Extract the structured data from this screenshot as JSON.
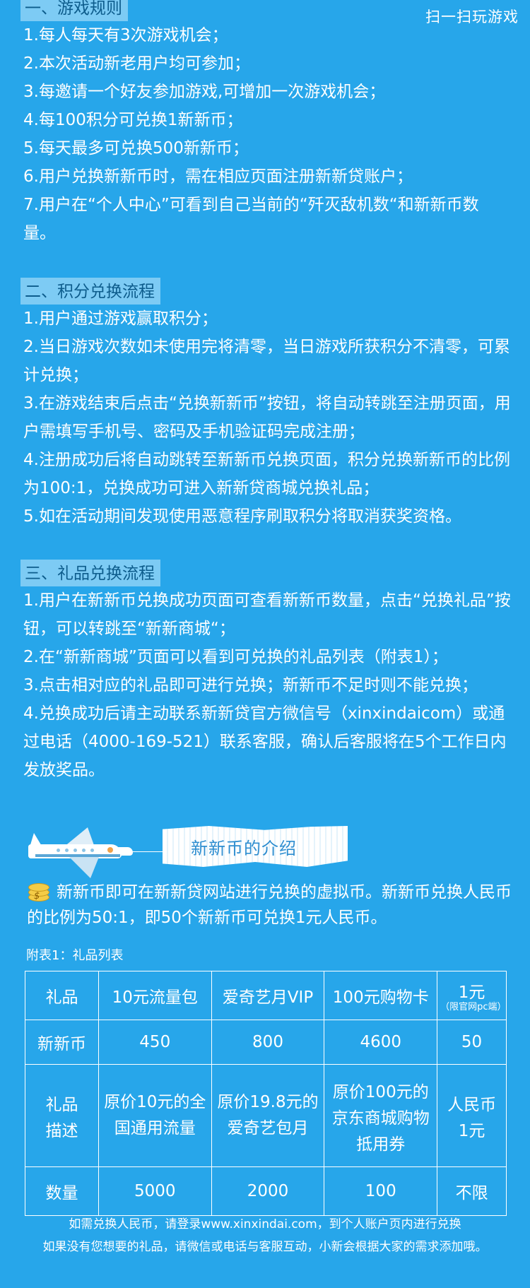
{
  "scan_link": "扫一扫玩游戏",
  "sections": [
    {
      "title": "一、游戏规则",
      "items": [
        "1.每人每天有3次游戏机会；",
        "2.本次活动新老用户均可参加；",
        "3.每邀请一个好友参加游戏,可增加一次游戏机会；",
        "4.每100积分可兑换1新新币；",
        "5.每天最多可兑换500新新币；",
        "6.用户兑换新新币时，需在相应页面注册新新贷账户；",
        "7.用户在“个人中心”可看到自己当前的“歼灭敌机数“和新新币数量。"
      ]
    },
    {
      "title": "二、积分兑换流程",
      "items": [
        "1.用户通过游戏赢取积分；",
        "2.当日游戏次数如未使用完将清零，当日游戏所获积分不清零，可累计兑换；",
        "3.在游戏结束后点击“兑换新新币”按钮，将自动转跳至注册页面，用户需填写手机号、密码及手机验证码完成注册；",
        "4.注册成功后将自动跳转至新新币兑换页面，积分兑换新新币的比例为100:1，兑换成功可进入新新贷商城兑换礼品；",
        "5.如在活动期间发现使用恶意程序刷取积分将取消获奖资格。"
      ]
    },
    {
      "title": "三、礼品兑换流程",
      "items": [
        "1.用户在新新币兑换成功页面可查看新新币数量，点击“兑换礼品”按钮，可以转跳至“新新商城“；",
        "2.在“新新商城”页面可以看到可兑换的礼品列表（附表1）；",
        "3.点击相对应的礼品即可进行兑换；新新币不足时则不能兑换；",
        "4.兑换成功后请主动联系新新贷官方微信号（xinxindaicom）或通过电话（4000-169-521）联系客服，确认后客服将在5个工作日内发放奖品。"
      ]
    }
  ],
  "banner_text": "新新币的介绍",
  "intro_text": "新新币即可在新新贷网站进行兑换的虚拟币。新新币兑换人民币的比例为50:1，即50个新新币可兑换1元人民币。",
  "coin_icon_glyph": "$",
  "table_caption": "附表1：礼品列表",
  "table": {
    "row_labels": [
      "礼品",
      "新新币",
      "礼品描述",
      "数量"
    ],
    "gifts": [
      {
        "name": "10元流量包",
        "note": "",
        "coins": "450",
        "desc": "原价10元的全国通用流量",
        "qty": "5000"
      },
      {
        "name": "爱奇艺月VIP",
        "note": "",
        "coins": "800",
        "desc": "原价19.8元的爱奇艺包月",
        "qty": "2000"
      },
      {
        "name": "100元购物卡",
        "note": "",
        "coins": "4600",
        "desc": "原价100元的京东商城购物抵用券",
        "qty": "100"
      },
      {
        "name": "1元",
        "note": "（限官网pc端）",
        "coins": "50",
        "desc": "人民币1元",
        "qty": "不限"
      }
    ]
  },
  "footer": [
    "如需兑换人民币，请登录www.xinxindai.com，到个人账户页内进行兑换",
    "如果没有您想要的礼品，请微信或电话与客服互动，小新会根据大家的需求添加哦。"
  ],
  "colors": {
    "background": "#27a6ea",
    "section_title_bg": "#7dcbf4",
    "section_title_text": "#0d5c8c"
  }
}
